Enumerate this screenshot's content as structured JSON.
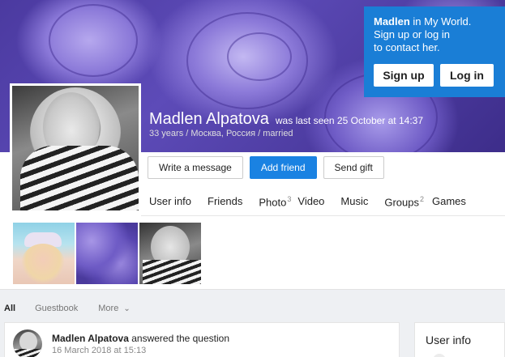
{
  "login": {
    "msg_name": "Madlen",
    "msg_rest": " in My World.",
    "msg_line2": "Sign up or log in",
    "msg_line3": "to contact her.",
    "signup_label": "Sign up",
    "login_label": "Log in"
  },
  "profile": {
    "name": "Madlen Alpatova",
    "last_seen": "was last seen 25 October at 14:37",
    "info": "33 years / Москва, Россия / married"
  },
  "actions": {
    "write_message": "Write a message",
    "add_friend": "Add friend",
    "send_gift": "Send gift"
  },
  "tabs": [
    {
      "label": "User info",
      "count": ""
    },
    {
      "label": "Friends",
      "count": ""
    },
    {
      "label": "Photo",
      "count": "3"
    },
    {
      "label": "Video",
      "count": ""
    },
    {
      "label": "Music",
      "count": ""
    },
    {
      "label": "Groups",
      "count": "2"
    },
    {
      "label": "Games",
      "count": ""
    }
  ],
  "feed_tabs": {
    "all": "All",
    "guestbook": "Guestbook",
    "more": "More"
  },
  "post": {
    "author": "Madlen Alpatova",
    "action": " answered the question",
    "date": "16 March 2018 at 15:13"
  },
  "sidebar": {
    "title": "User info"
  },
  "colors": {
    "accent": "#1a82e2",
    "login_bg": "#1a7ed6"
  }
}
